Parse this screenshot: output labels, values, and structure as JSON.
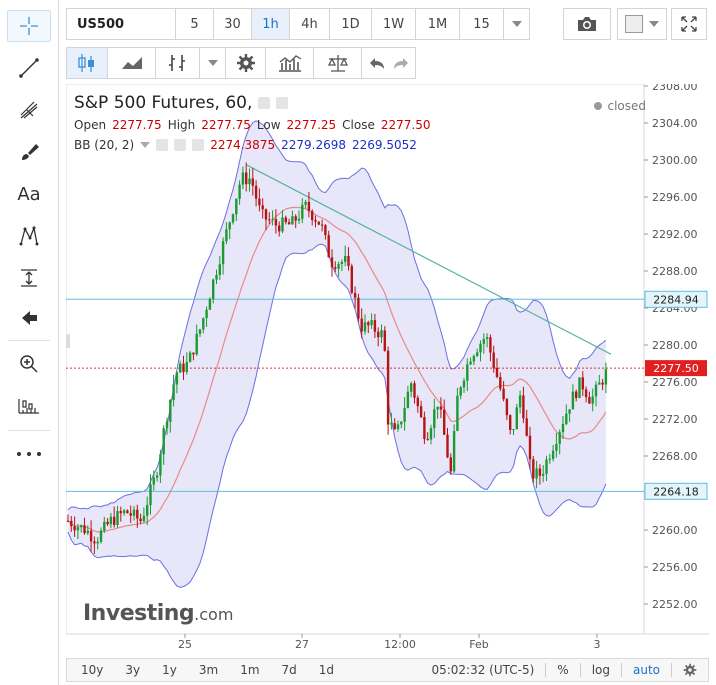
{
  "toolbar": {
    "symbol": "US500",
    "intervals": [
      "5",
      "30",
      "1h",
      "4h",
      "1D",
      "1W",
      "1M",
      "15"
    ],
    "selected_interval": "1h"
  },
  "legend": {
    "title": "S&P 500 Futures, 60,",
    "open_label": "Open",
    "open": "2277.75",
    "high_label": "High",
    "high": "2277.75",
    "low_label": "Low",
    "low": "2277.25",
    "close_label": "Close",
    "close": "2277.50",
    "bb_label": "BB (20, 2)",
    "bb_mid": "2274.3875",
    "bb_upper": "2279.2698",
    "bb_lower": "2269.5052",
    "status": "closed"
  },
  "chart": {
    "price_labels": [
      "2308.00",
      "2304.00",
      "2300.00",
      "2296.00",
      "2292.00",
      "2288.00",
      "2284.00",
      "2280.00",
      "2276.00",
      "2272.00",
      "2268.00",
      "2264.00",
      "2260.00",
      "2256.00",
      "2252.00"
    ],
    "time_labels": [
      "25",
      "27",
      "12:00",
      "Feb",
      "3"
    ],
    "marker_high": "2284.94",
    "marker_close": "2277.50",
    "marker_low": "2264.18",
    "logo_main": "Investing",
    "logo_suffix": ".com",
    "colors": {
      "up": "#1a9a2f",
      "down": "#b51515",
      "band": "#6b6fe0",
      "basis": "#e88a8a",
      "hline": "#5bc0de",
      "trend": "#4fb3a0",
      "closeLine": "#e03030"
    }
  },
  "bottom": {
    "ranges": [
      "10y",
      "3y",
      "1y",
      "3m",
      "1m",
      "7d",
      "1d"
    ],
    "time": "05:02:32 (UTC-5)",
    "percent": "%",
    "log": "log",
    "auto": "auto"
  },
  "icons": [
    "crosshair-icon",
    "trend-line-icon",
    "fib-icon",
    "brush-icon",
    "text-icon",
    "pattern-icon",
    "measure-icon",
    "back-arrow-icon",
    "zoom-icon",
    "ruler-icon",
    "more-icon",
    "camera-icon",
    "fullscreen-icon",
    "candles-icon",
    "indicators-icon",
    "settings-icon",
    "compare-icon",
    "undo-icon",
    "redo-icon",
    "gear-icon"
  ]
}
